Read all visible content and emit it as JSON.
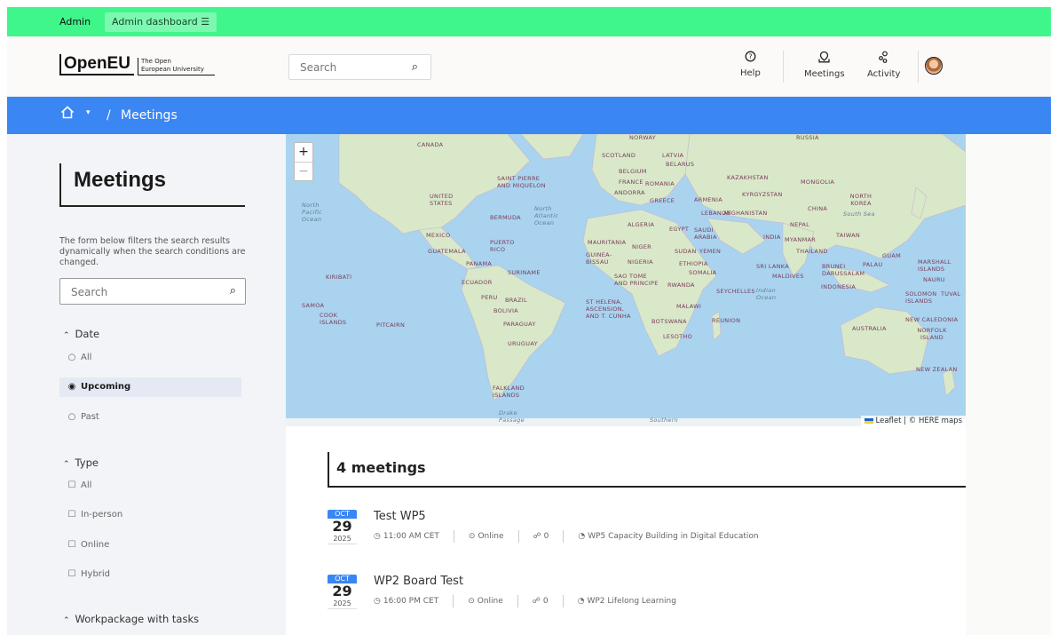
{
  "admin_bar": {
    "label": "Admin",
    "dashboard_label": "Admin dashboard ☰"
  },
  "header": {
    "logo": {
      "brand": "OpenEU",
      "tagline_1": "The Open",
      "tagline_2": "European University"
    },
    "search_placeholder": "Search",
    "nav": [
      {
        "label": "Help",
        "icon": "help-circle-icon",
        "glyph": "?"
      },
      {
        "label": "Meetings",
        "icon": "meetings-icon",
        "glyph": "⌬"
      },
      {
        "label": "Activity",
        "icon": "activity-icon",
        "glyph": "⁂"
      }
    ],
    "avatar_icon": "user-avatar"
  },
  "breadcrumb": {
    "home_icon": "home-icon",
    "separator": "/",
    "current": "Meetings"
  },
  "sidebar": {
    "title": "Meetings",
    "help_text": "The form below filters the search results dynamically when the search conditions are changed.",
    "search_placeholder": "Search",
    "date_filter": {
      "title": "Date",
      "options": [
        {
          "label": "All",
          "selected": false
        },
        {
          "label": "Upcoming",
          "selected": true
        },
        {
          "label": "Past",
          "selected": false
        }
      ]
    },
    "type_filter": {
      "title": "Type",
      "options": [
        {
          "label": "All",
          "checked": false
        },
        {
          "label": "In-person",
          "checked": false
        },
        {
          "label": "Online",
          "checked": false
        },
        {
          "label": "Hybrid",
          "checked": false
        }
      ]
    },
    "workpackage_filter": {
      "title": "Workpackage with tasks"
    }
  },
  "map": {
    "zoom_in": "+",
    "zoom_out": "−",
    "attribution": "Leaflet | © HERE maps",
    "labels": {
      "canada": "CANADA",
      "norway": "NORWAY",
      "russia": "RUSSIA",
      "scotland": "SCOTLAND",
      "latvia": "LATVIA",
      "belarus": "BELARUS",
      "belgium": "BELGIUM",
      "france": "FRANCE",
      "romania": "ROMANIA",
      "andorra": "ANDORRA",
      "greece": "GREECE",
      "armenia": "ARMENIA",
      "kazakhstan": "KAZAKHSTAN",
      "mongolia": "MONGOLIA",
      "kyrgyzstan": "KYRGYZSTAN",
      "north_korea": "NORTH KOREA",
      "china": "CHINA",
      "south_sea": "South Sea",
      "saint_pierre": "SAINT PIERRE AND MIQUELON",
      "united_states": "UNITED STATES",
      "north_pacific": "North Pacific Ocean",
      "north_atlantic": "North Atlantic Ocean",
      "bermuda": "BERMUDA",
      "lebanon": "LEBANON",
      "afghanistan": "AFGHANISTAN",
      "algeria": "ALGERIA",
      "egypt": "EGYPT",
      "saudi_arabia": "SAUDI ARABIA",
      "nepal": "NEPAL",
      "taiwan": "TAIWAN",
      "india": "INDIA",
      "myanmar": "MYANMAR",
      "mexico": "MEXICO",
      "puerto_rico": "PUERTO RICO",
      "guatemala": "GUATEMALA",
      "mauritania": "MAURITANIA",
      "niger": "NIGER",
      "sudan": "SUDAN",
      "yemen": "YEMEN",
      "thailand": "THAILAND",
      "guam": "GUAM",
      "marshall": "MARSHALL ISLANDS",
      "panama": "PANAMA",
      "suriname": "SURINAME",
      "guinea_bissau": "GUINEA-BISSAU",
      "nigeria": "NIGERIA",
      "ethiopia": "ETHIOPIA",
      "sri_lanka": "SRI LANKA",
      "brunei": "BRUNEI DARUSSALAM",
      "palau": "PALAU",
      "nauru": "NAURU",
      "kiribati": "KIRIBATI",
      "ecuador": "ECUADOR",
      "sao_tome": "SAO TOME AND PRINCIPE",
      "somalia": "SOMALIA",
      "rwanda": "RWANDA",
      "maldives": "MALDIVES",
      "indonesia": "INDONESIA",
      "solomon": "SOLOMON ISLANDS",
      "tuvalu": "TUVAL",
      "peru": "PERU",
      "brazil": "BRAZIL",
      "seychelles": "SEYCHELLES",
      "indian_ocean": "Indian Ocean",
      "samoa": "SAMOA",
      "cook": "COOK ISLANDS",
      "bolivia": "BOLIVIA",
      "st_helena": "ST HELENA, ASCENSION, AND T. CUNHA",
      "malawi": "MALAWI",
      "pitcairn": "PITCAIRN",
      "paraguay": "PARAGUAY",
      "botswana": "BOTSWANA",
      "reunion": "REUNION",
      "australia": "AUSTRALIA",
      "new_caledonia": "NEW CALEDONIA",
      "norfolk": "NORFOLK ISLAND",
      "uruguay": "URUGUAY",
      "lesotho": "LESOTHO",
      "new_zealand": "NEW ZEALAN",
      "falkland": "FALKLAND ISLANDS",
      "drake": "Drake Passage",
      "southern": "Southern"
    }
  },
  "results": {
    "count_label": "4 meetings",
    "meetings": [
      {
        "month": "OCT",
        "day": "29",
        "year": "2025",
        "title": "Test WP5",
        "time": "11:00 AM CET",
        "type": "Online",
        "comments": "0",
        "workpackage": "WP5 Capacity Building in Digital Education"
      },
      {
        "month": "OCT",
        "day": "29",
        "year": "2025",
        "title": "WP2 Board Test",
        "time": "16:00 PM CET",
        "type": "Online",
        "comments": "0",
        "workpackage": "WP2 Lifelong Learning"
      }
    ]
  },
  "colors": {
    "admin_bar": "#3ef68a",
    "breadcrumb": "#3a86f3",
    "sidebar": "#f2f4f7",
    "ocean": "#a9d3ef",
    "land": "#d7e7c8"
  }
}
